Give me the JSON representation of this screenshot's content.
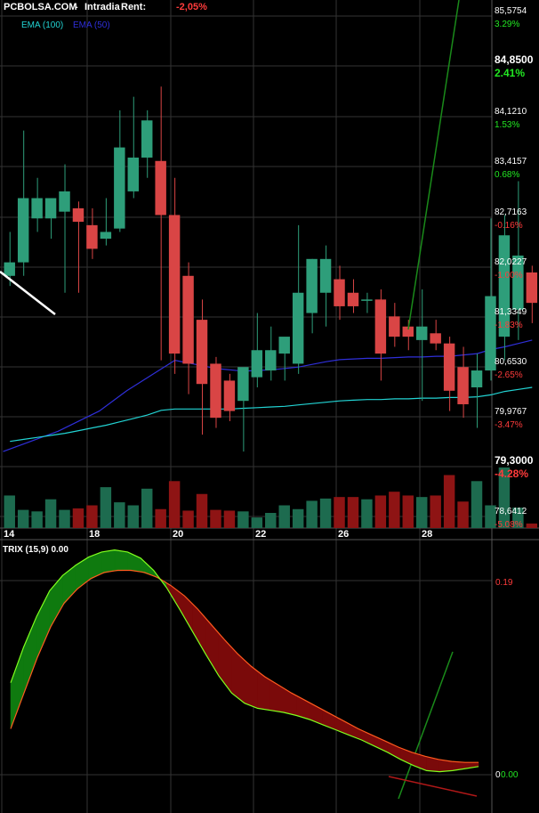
{
  "header": {
    "site": "PCBOLSA.COM",
    "sep": "-",
    "mode": "Intradia",
    "rent_label": "Rent:",
    "rent_value": "-2,05%"
  },
  "legend": {
    "ema100": "EMA (100)",
    "ema50": "EMA (50)"
  },
  "trix": {
    "label": "TRIX (15,9)",
    "value": "0.00",
    "axis_top": "0.19",
    "axis_zero": "0",
    "axis_current": "0.00"
  },
  "colors": {
    "up": "#2e9e7a",
    "down": "#d94545",
    "vol_up": "#1d6b4f",
    "vol_down": "#8e1414",
    "ema100": "#2f2fd9",
    "ema50": "#22d3d3",
    "trix": "#7fff1e",
    "signal": "#ff5a1e"
  },
  "chart_data": [
    {
      "type": "candlestick",
      "ylim": [
        78.35,
        85.9
      ],
      "x_ticks": [
        "14",
        "18",
        "20",
        "22",
        "26",
        "28"
      ],
      "y_ticks": [
        {
          "price": "85,5754",
          "pct": "3.29%"
        },
        {
          "price": "84,8500",
          "pct": "2.41%"
        },
        {
          "price": "84,1210",
          "pct": "1.53%"
        },
        {
          "price": "83,4157",
          "pct": "0.68%"
        },
        {
          "price": "82,7163",
          "pct": "-0.16%"
        },
        {
          "price": "82,0227",
          "pct": "-1.00%"
        },
        {
          "price": "81,3349",
          "pct": "-1.83%"
        },
        {
          "price": "80,6530",
          "pct": "-2.65%"
        },
        {
          "price": "79,9767",
          "pct": "-3.47%"
        },
        {
          "price": "79,3000",
          "pct": "-4.28%"
        },
        {
          "price": "78,6412",
          "pct": "-5.08%"
        }
      ],
      "candles": [
        {
          "o": 81.95,
          "h": 82.6,
          "l": 81.8,
          "c": 82.15
        },
        {
          "o": 82.15,
          "h": 84.1,
          "l": 81.95,
          "c": 83.1
        },
        {
          "o": 82.8,
          "h": 83.4,
          "l": 82.6,
          "c": 83.1
        },
        {
          "o": 82.8,
          "h": 83.1,
          "l": 82.5,
          "c": 83.1
        },
        {
          "o": 82.9,
          "h": 83.6,
          "l": 81.7,
          "c": 83.2
        },
        {
          "o": 82.95,
          "h": 83.05,
          "l": 81.7,
          "c": 82.75
        },
        {
          "o": 82.7,
          "h": 82.95,
          "l": 82.2,
          "c": 82.35
        },
        {
          "o": 82.5,
          "h": 83.1,
          "l": 82.4,
          "c": 82.6
        },
        {
          "o": 82.65,
          "h": 84.4,
          "l": 82.6,
          "c": 83.85
        },
        {
          "o": 83.2,
          "h": 84.6,
          "l": 83.1,
          "c": 83.7
        },
        {
          "o": 83.7,
          "h": 84.4,
          "l": 83.4,
          "c": 84.25
        },
        {
          "o": 83.65,
          "h": 84.75,
          "l": 80.7,
          "c": 82.85
        },
        {
          "o": 82.85,
          "h": 83.4,
          "l": 80.5,
          "c": 80.8
        },
        {
          "o": 81.95,
          "h": 82.15,
          "l": 80.2,
          "c": 80.65
        },
        {
          "o": 81.3,
          "h": 81.6,
          "l": 79.6,
          "c": 80.35
        },
        {
          "o": 80.65,
          "h": 80.75,
          "l": 79.7,
          "c": 79.85
        },
        {
          "o": 80.4,
          "h": 80.5,
          "l": 79.8,
          "c": 79.95
        },
        {
          "o": 80.1,
          "h": 80.4,
          "l": 79.35,
          "c": 80.6
        },
        {
          "o": 80.45,
          "h": 81.4,
          "l": 80.3,
          "c": 80.85
        },
        {
          "o": 80.55,
          "h": 81.2,
          "l": 80.4,
          "c": 80.85
        },
        {
          "o": 80.8,
          "h": 80.95,
          "l": 80.4,
          "c": 81.05
        },
        {
          "o": 80.65,
          "h": 82.7,
          "l": 80.5,
          "c": 81.7
        },
        {
          "o": 81.4,
          "h": 82.2,
          "l": 81.1,
          "c": 82.2
        },
        {
          "o": 81.7,
          "h": 82.4,
          "l": 81.2,
          "c": 82.2
        },
        {
          "o": 81.9,
          "h": 82.1,
          "l": 81.3,
          "c": 81.5
        },
        {
          "o": 81.7,
          "h": 81.9,
          "l": 81.4,
          "c": 81.5
        },
        {
          "o": 81.6,
          "h": 81.7,
          "l": 81.4,
          "c": 81.6
        },
        {
          "o": 81.6,
          "h": 81.75,
          "l": 80.4,
          "c": 80.8
        },
        {
          "o": 81.35,
          "h": 81.55,
          "l": 80.9,
          "c": 81.05
        },
        {
          "o": 81.2,
          "h": 81.3,
          "l": 80.85,
          "c": 81.05
        },
        {
          "o": 81.0,
          "h": 81.75,
          "l": 80.1,
          "c": 81.2
        },
        {
          "o": 81.1,
          "h": 81.3,
          "l": 80.85,
          "c": 80.95
        },
        {
          "o": 80.95,
          "h": 81.05,
          "l": 79.95,
          "c": 80.25
        },
        {
          "o": 80.6,
          "h": 80.9,
          "l": 79.85,
          "c": 80.05
        },
        {
          "o": 80.3,
          "h": 80.8,
          "l": 79.7,
          "c": 80.55
        },
        {
          "o": 80.55,
          "h": 82.8,
          "l": 80.4,
          "c": 81.65
        },
        {
          "o": 81.05,
          "h": 82.85,
          "l": 80.7,
          "c": 82.55
        },
        {
          "o": 81.45,
          "h": 83.35,
          "l": 81.0,
          "c": 82.25
        },
        {
          "o": 82.0,
          "h": 82.1,
          "l": 81.25,
          "c": 81.55
        }
      ],
      "volume_relative": [
        0.43,
        0.24,
        0.22,
        0.38,
        0.24,
        0.26,
        0.3,
        0.54,
        0.34,
        0.3,
        0.52,
        0.25,
        0.62,
        0.23,
        0.45,
        0.24,
        0.23,
        0.22,
        0.14,
        0.2,
        0.3,
        0.25,
        0.36,
        0.39,
        0.41,
        0.41,
        0.38,
        0.43,
        0.48,
        0.43,
        0.41,
        0.43,
        0.7,
        0.35,
        0.62,
        0.3,
        0.8,
        0.27,
        0.06
      ],
      "ema100": [
        null,
        null,
        null,
        null,
        null,
        null,
        null,
        null,
        null,
        null,
        null,
        null,
        80.7,
        80.66,
        80.62,
        80.58,
        80.56,
        80.54,
        80.55,
        80.56,
        80.58,
        80.6,
        80.64,
        80.68,
        80.71,
        80.72,
        80.73,
        80.73,
        80.74,
        80.75,
        80.75,
        80.76,
        80.76,
        80.78,
        80.8,
        80.86,
        80.9,
        80.95,
        81.0
      ],
      "ema50": [
        79.5,
        79.53,
        79.56,
        79.59,
        79.62,
        79.66,
        79.7,
        79.74,
        79.79,
        79.84,
        79.89,
        79.96,
        79.98,
        79.98,
        79.98,
        79.98,
        79.98,
        79.99,
        80.0,
        80.01,
        80.02,
        80.04,
        80.06,
        80.08,
        80.1,
        80.11,
        80.12,
        80.12,
        80.13,
        80.13,
        80.14,
        80.14,
        80.15,
        80.15,
        80.16,
        80.19,
        80.24,
        80.27,
        80.3
      ]
    },
    {
      "type": "line",
      "title": "TRIX (15,9)",
      "ylim": [
        -0.03,
        0.23
      ],
      "series": [
        {
          "values": [
            0.09,
            0.125,
            0.155,
            0.18,
            0.195,
            0.205,
            0.213,
            0.218,
            0.22,
            0.218,
            0.212,
            0.2,
            0.183,
            0.162,
            0.14,
            0.118,
            0.097,
            0.08,
            0.07,
            0.065,
            0.063,
            0.061,
            0.058,
            0.054,
            0.049,
            0.044,
            0.039,
            0.034,
            0.028,
            0.022,
            0.015,
            0.009,
            0.004,
            0.003,
            0.004,
            0.006,
            0.008
          ]
        },
        {
          "values": [
            0.045,
            0.08,
            0.115,
            0.145,
            0.168,
            0.182,
            0.192,
            0.198,
            0.2,
            0.2,
            0.198,
            0.193,
            0.185,
            0.175,
            0.162,
            0.147,
            0.132,
            0.118,
            0.106,
            0.096,
            0.088,
            0.08,
            0.073,
            0.066,
            0.059,
            0.052,
            0.045,
            0.039,
            0.033,
            0.027,
            0.022,
            0.018,
            0.015,
            0.013,
            0.012,
            0.012
          ]
        }
      ]
    }
  ]
}
